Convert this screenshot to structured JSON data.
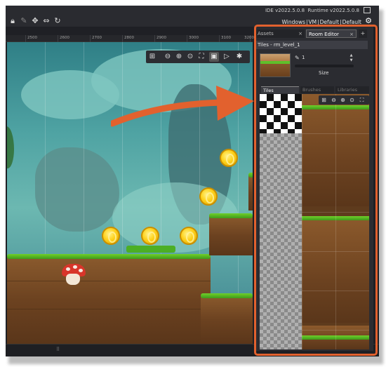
{
  "window": {
    "ide_version": "IDE v2022.5.0.8",
    "runtime_version": "Runtime v2022.5.0.8",
    "menu": [
      "Windows",
      "VM",
      "Default",
      "Default"
    ]
  },
  "ruler": {
    "labels": [
      "2500",
      "2600",
      "2700",
      "2800",
      "2900",
      "3000",
      "3100",
      "3200"
    ]
  },
  "room_toolbar": {
    "icons": [
      "grid-icon",
      "zoom-out-icon",
      "zoom-in-icon",
      "zoom-reset-icon",
      "fit-icon",
      "select-icon",
      "play-icon",
      "screenshot-icon"
    ]
  },
  "panel": {
    "tabs": [
      {
        "label": "Assets",
        "close": "×"
      },
      {
        "label": "Room Editor",
        "close": "×"
      }
    ],
    "add_tab": "+",
    "room_name": "Tiles - rm_level_1",
    "brush_size_value": "1",
    "size_label": "Size",
    "subtabs": [
      "Tiles",
      "Brushes",
      "Libraries"
    ]
  },
  "colors": {
    "highlight": "#e2612e",
    "coin": "#ffd21c",
    "grass": "#5fbf2a"
  }
}
